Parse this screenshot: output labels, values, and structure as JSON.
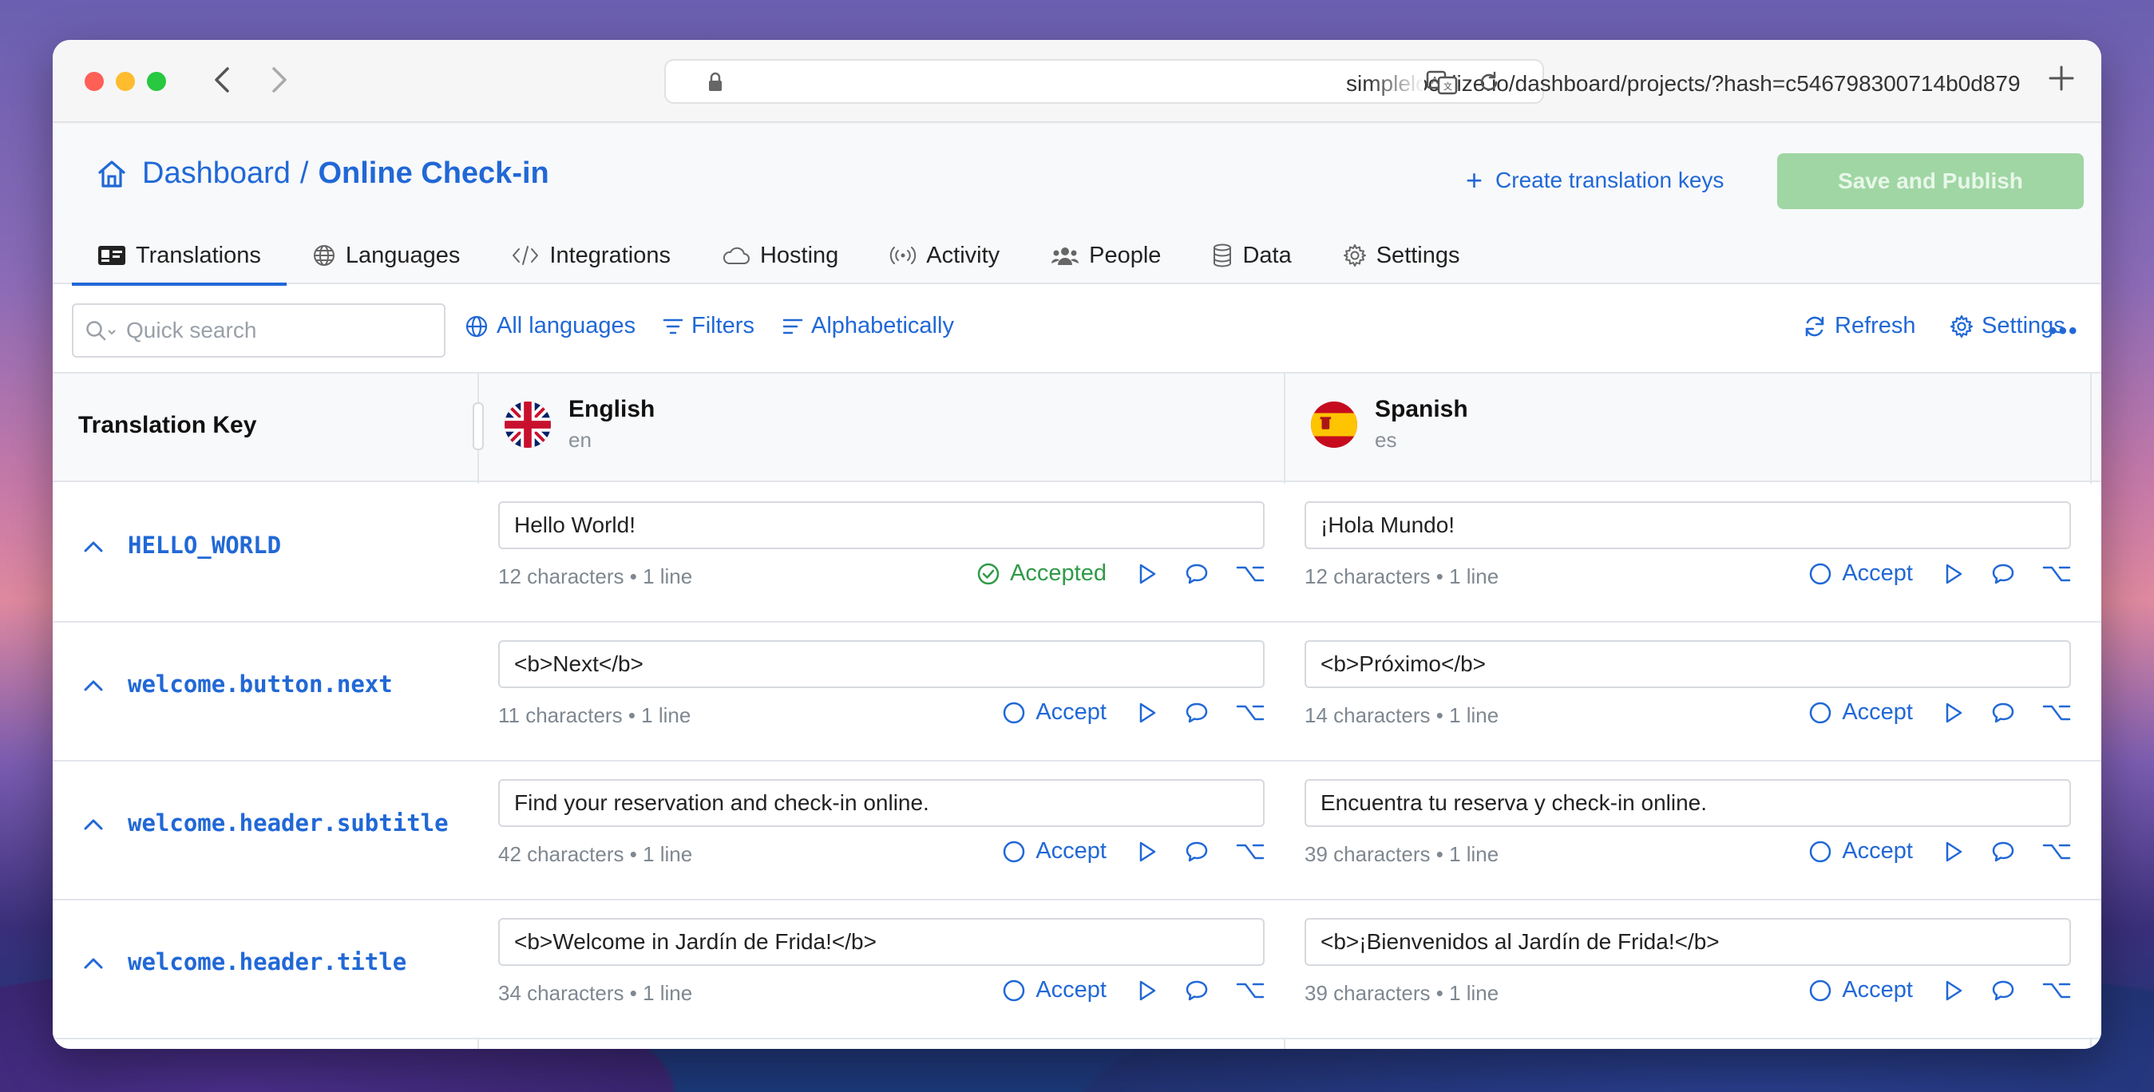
{
  "browser": {
    "url": "simplelocalize.io/dashboard/projects/?hash=c546798300714b0d879"
  },
  "breadcrumb": {
    "parent": "Dashboard",
    "separator": "/",
    "current": "Online Check-in"
  },
  "header": {
    "create_keys_label": "Create translation keys",
    "save_label": "Save and Publish"
  },
  "tabs": [
    {
      "label": "Translations",
      "icon": "id-card-icon",
      "active": true
    },
    {
      "label": "Languages",
      "icon": "globe-icon"
    },
    {
      "label": "Integrations",
      "icon": "code-icon"
    },
    {
      "label": "Hosting",
      "icon": "cloud-icon"
    },
    {
      "label": "Activity",
      "icon": "broadcast-icon"
    },
    {
      "label": "People",
      "icon": "people-icon"
    },
    {
      "label": "Data",
      "icon": "database-icon"
    },
    {
      "label": "Settings",
      "icon": "gear-icon"
    }
  ],
  "toolbar": {
    "search_placeholder": "Quick search",
    "languages_label": "All languages",
    "filters_label": "Filters",
    "sort_label": "Alphabetically",
    "refresh_label": "Refresh",
    "settings_label": "Settings",
    "more_label": "•••"
  },
  "table": {
    "key_header": "Translation Key",
    "languages": [
      {
        "name": "English",
        "code": "en"
      },
      {
        "name": "Spanish",
        "code": "es"
      }
    ],
    "rows": [
      {
        "key": "HELLO_WORLD",
        "en": {
          "text": "Hello World!",
          "counts": "12 characters • 1 line",
          "status": "Accepted"
        },
        "es": {
          "text": "¡Hola Mundo!",
          "counts": "12 characters • 1 line",
          "status": "Accept"
        }
      },
      {
        "key": "welcome.button.next",
        "en": {
          "text": "<b>Next</b>",
          "counts": "11 characters • 1 line",
          "status": "Accept"
        },
        "es": {
          "text": "<b>Próximo</b>",
          "counts": "14 characters • 1 line",
          "status": "Accept"
        }
      },
      {
        "key": "welcome.header.subtitle",
        "en": {
          "text": "Find your reservation and check-in online.",
          "counts": "42 characters • 1 line",
          "status": "Accept"
        },
        "es": {
          "text": "Encuentra tu reserva y check-in online.",
          "counts": "39 characters • 1 line",
          "status": "Accept"
        }
      },
      {
        "key": "welcome.header.title",
        "en": {
          "text": "<b>Welcome in Jardín de Frida!</b>",
          "counts": "34 characters • 1 line",
          "status": "Accept"
        },
        "es": {
          "text": "<b>¡Bienvenidos al Jardín de Frida!</b>",
          "counts": "39 characters • 1 line",
          "status": "Accept"
        }
      }
    ]
  },
  "colors": {
    "accent": "#2168d6",
    "accepted": "#2f9a48",
    "save_disabled": "#9fd6a3"
  }
}
